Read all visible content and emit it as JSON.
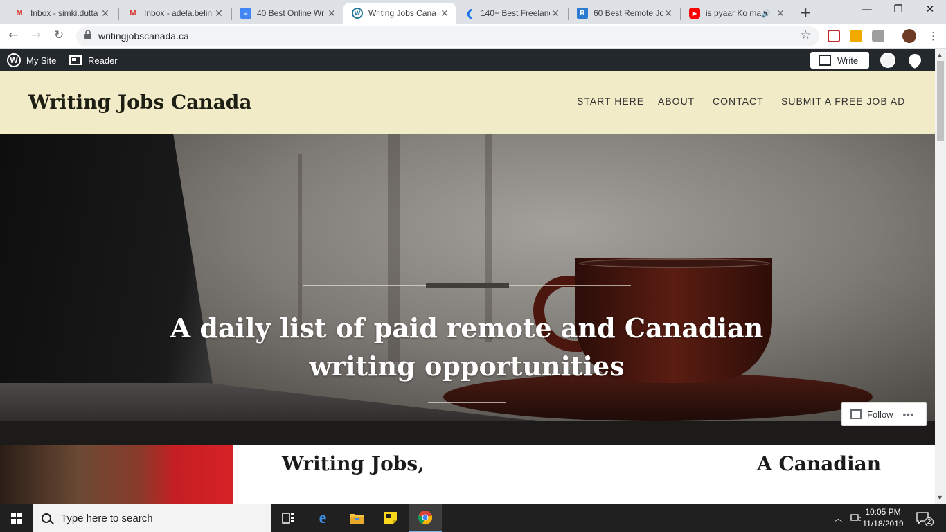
{
  "browser": {
    "tabs": [
      {
        "title": "Inbox - simki.dutta",
        "icon": "gmail-icon",
        "color": "#d93025"
      },
      {
        "title": "Inbox - adela.belin",
        "icon": "gmail-icon",
        "color": "#d93025"
      },
      {
        "title": "40 Best Online Wr",
        "icon": "docs-icon",
        "color": "#4285f4"
      },
      {
        "title": "Writing Jobs Cana",
        "icon": "wordpress-icon",
        "color": "#21759b"
      },
      {
        "title": "140+ Best Freelanc",
        "icon": "site-icon",
        "color": "#1a73e8"
      },
      {
        "title": "60 Best Remote Jo",
        "icon": "site-icon",
        "color": "#2b7bd3"
      },
      {
        "title": "is pyaar Ko ma",
        "icon": "youtube-icon",
        "color": "#ff0000"
      }
    ],
    "active_tab": 3,
    "url": "writingjobscanada.ca",
    "new_tab_symbol": "+",
    "controls": {
      "minimize": "—",
      "maximize": "❐",
      "close": "✕"
    }
  },
  "wp_admin_bar": {
    "my_site": "My Site",
    "reader": "Reader",
    "write": "Write"
  },
  "site": {
    "title": "Writing Jobs Canada",
    "nav": [
      "START HERE",
      "ABOUT",
      "CONTACT",
      "SUBMIT A FREE JOB AD"
    ],
    "tagline": "A daily list of paid remote and Canadian writing opportunities",
    "posts": [
      {
        "title": "Writing Jobs,"
      },
      {
        "title": "A Canadian"
      }
    ],
    "follow": {
      "label": "Follow",
      "more": "•••"
    }
  },
  "taskbar": {
    "search_placeholder": "Type here to search",
    "time": "10:05 PM",
    "date": "11/18/2019",
    "notification_count": "2"
  },
  "colors": {
    "header_bg": "#f2ebc7",
    "wp_bar": "#23282d",
    "taskbar": "#202020"
  }
}
